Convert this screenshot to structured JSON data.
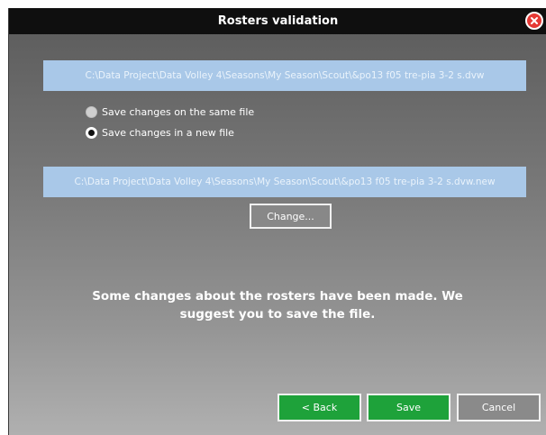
{
  "dialog": {
    "title": "Rosters validation",
    "source_path": "C:\\Data Project\\Data Volley 4\\Seasons\\My Season\\Scout\\&po13 f05 tre-pia 3-2 s.dvw",
    "options": [
      {
        "label": "Save changes on the same file",
        "selected": false
      },
      {
        "label": "Save changes in a new file",
        "selected": true
      }
    ],
    "new_path": "C:\\Data Project\\Data Volley 4\\Seasons\\My Season\\Scout\\&po13 f05 tre-pia 3-2 s.dvw.new",
    "change_label": "Change...",
    "message": "Some changes about the rosters have been made. We suggest you to save the file.",
    "buttons": {
      "back": "< Back",
      "save": "Save",
      "cancel": "Cancel"
    }
  },
  "colors": {
    "path_box": "#a9c8e8",
    "accent_green": "#1ea23a",
    "close_red": "#e53935",
    "titlebar": "#0f0f0f"
  }
}
